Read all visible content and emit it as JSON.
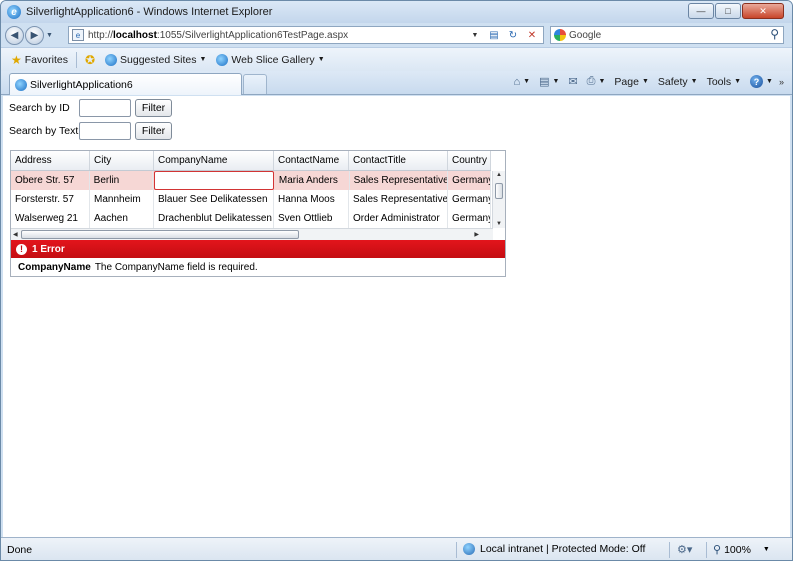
{
  "window": {
    "title": "SilverlightApplication6 - Windows Internet Explorer"
  },
  "address": {
    "prefix": "http://",
    "host": "localhost",
    "path": ":1055/SilverlightApplication6TestPage.aspx"
  },
  "search": {
    "engine": "Google"
  },
  "favorites": {
    "favorites_label": "Favorites",
    "suggested_sites": "Suggested Sites",
    "web_slice_gallery": "Web Slice Gallery"
  },
  "tab": {
    "label": "SilverlightApplication6"
  },
  "commands": {
    "page": "Page",
    "safety": "Safety",
    "tools": "Tools"
  },
  "form": {
    "search_id_label": "Search by ID",
    "search_text_label": "Search by Text",
    "filter_label": "Filter",
    "search_id_value": "",
    "search_text_value": ""
  },
  "grid": {
    "columns": [
      "Address",
      "City",
      "CompanyName",
      "ContactName",
      "ContactTitle",
      "Country"
    ],
    "rows": [
      [
        "Obere Str. 57",
        "Berlin",
        "",
        "Maria Anders",
        "Sales Representative",
        "Germany"
      ],
      [
        "Forsterstr. 57",
        "Mannheim",
        "Blauer See Delikatessen",
        "Hanna Moos",
        "Sales Representative",
        "Germany"
      ],
      [
        "Walserweg 21",
        "Aachen",
        "Drachenblut Delikatessen",
        "Sven Ottlieb",
        "Order Administrator",
        "Germany"
      ]
    ]
  },
  "validation": {
    "summary": "1 Error",
    "field": "CompanyName",
    "message": "The CompanyName field is required."
  },
  "status": {
    "left": "Done",
    "zone": "Local intranet | Protected Mode: Off",
    "zoom": "100%"
  },
  "colors": {
    "error_red": "#d50f15",
    "error_row": "#f6d7d5"
  }
}
